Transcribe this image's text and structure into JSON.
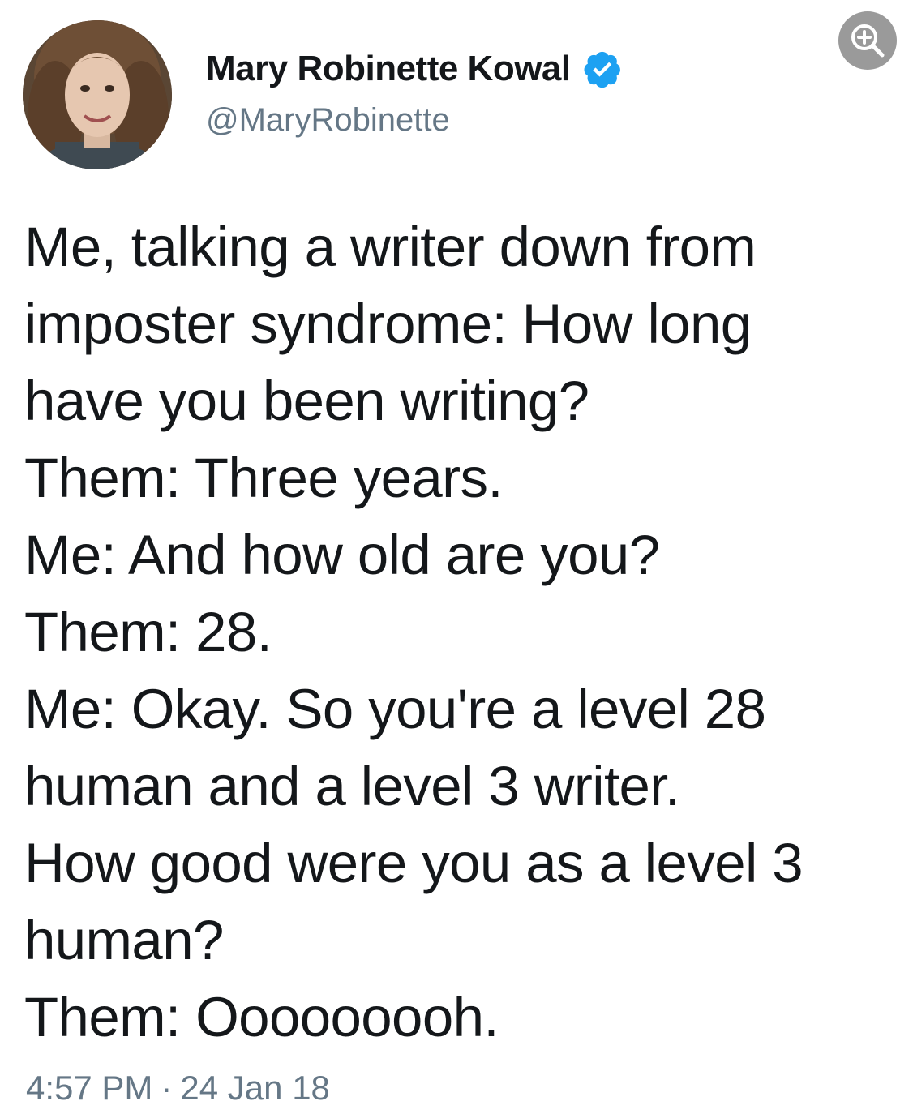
{
  "author": {
    "display_name": "Mary Robinette Kowal",
    "handle": "@MaryRobinette",
    "verified_icon": "verified-badge-icon",
    "avatar_icon": "profile-photo"
  },
  "tweet": {
    "lines": [
      "Me, talking a writer down from",
      "imposter syndrome: How long",
      "have you been writing?",
      "Them: Three years.",
      "Me: And how old are you?",
      "Them: 28.",
      "Me: Okay. So you're a level 28",
      "human and a level 3 writer.",
      "How good were you as a level 3",
      "human?",
      "Them: Ooooooooh."
    ]
  },
  "meta": {
    "time": "4:57 PM",
    "separator": "·",
    "date": "24 Jan 18"
  },
  "controls": {
    "zoom_icon": "zoom-in-icon"
  },
  "colors": {
    "text": "#14171a",
    "secondary_text": "#657786",
    "verified_blue": "#1da1f2",
    "zoom_button_bg": "#9a9a9a"
  }
}
